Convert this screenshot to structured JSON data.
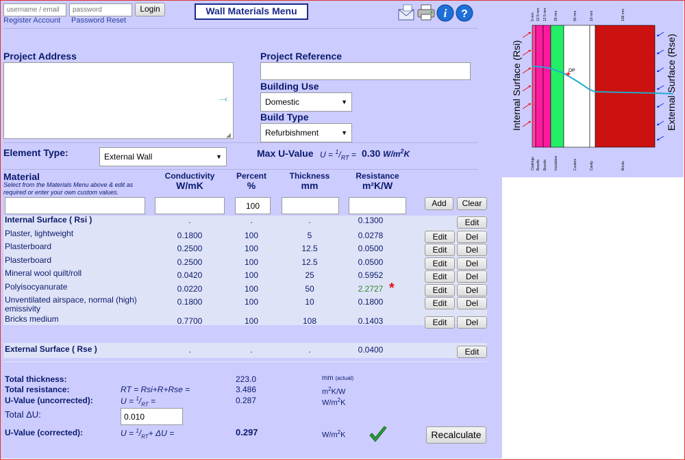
{
  "login": {
    "username_placeholder": "username / email",
    "password_placeholder": "password",
    "login_label": "Login",
    "register_label": "Register Account",
    "reset_label": "Password Reset"
  },
  "menu_title": "Wall Materials Menu",
  "project": {
    "address_label": "Project Address",
    "address_value": "",
    "reference_label": "Project Reference",
    "reference_value": "",
    "building_use_label": "Building Use",
    "building_use_value": "Domestic",
    "build_type_label": "Build Type",
    "build_type_value": "Refurbishment"
  },
  "element": {
    "label": "Element Type:",
    "value": "External Wall",
    "max_u_label": "Max U-Value",
    "max_u_value": "0.30"
  },
  "table": {
    "material_header": "Material",
    "material_hint": "Select from the Materials Menu above & edit as required or enter your own custom values.",
    "conductivity_header": "Conductivity",
    "conductivity_unit": "W/mK",
    "percent_header": "Percent",
    "percent_unit": "%",
    "thickness_header": "Thickness",
    "thickness_unit": "mm",
    "resistance_header": "Resistance",
    "resistance_unit": "m²K/W",
    "entry_percent_value": "100",
    "add_label": "Add",
    "clear_label": "Clear",
    "edit_label": "Edit",
    "del_label": "Del",
    "rows": [
      {
        "name": "Internal Surface ( Rsi )",
        "conductivity": ".",
        "percent": ".",
        "thickness": ".",
        "resistance": "0.1300",
        "kind": "surface"
      },
      {
        "name": "Plaster, lightweight",
        "conductivity": "0.1800",
        "percent": "100",
        "thickness": "5",
        "resistance": "0.0278",
        "kind": "layer"
      },
      {
        "name": "Plasterboard",
        "conductivity": "0.2500",
        "percent": "100",
        "thickness": "12.5",
        "resistance": "0.0500",
        "kind": "layer"
      },
      {
        "name": "Plasterboard",
        "conductivity": "0.2500",
        "percent": "100",
        "thickness": "12.5",
        "resistance": "0.0500",
        "kind": "layer"
      },
      {
        "name": "Mineral wool quilt/roll",
        "conductivity": "0.0420",
        "percent": "100",
        "thickness": "25",
        "resistance": "0.5952",
        "kind": "layer"
      },
      {
        "name": "Polyisocyanurate",
        "conductivity": "0.0220",
        "percent": "100",
        "thickness": "50",
        "resistance": "2.2727",
        "kind": "layer",
        "flag": "*"
      },
      {
        "name": "Unventilated airspace, normal (high) emissivity",
        "conductivity": "0.1800",
        "percent": "100",
        "thickness": "10",
        "resistance": "0.1800",
        "kind": "layer"
      },
      {
        "name": "Bricks medium",
        "conductivity": "0.7700",
        "percent": "100",
        "thickness": "108",
        "resistance": "0.1403",
        "kind": "layer"
      },
      {
        "name": "External Surface ( Rse )",
        "conductivity": ".",
        "percent": ".",
        "thickness": ".",
        "resistance": "0.0400",
        "kind": "surface"
      }
    ]
  },
  "totals": {
    "thickness_label": "Total thickness:",
    "thickness_value": "223.0",
    "thickness_unit": "mm",
    "thickness_unit_note": "(actual)",
    "resistance_label": "Total resistance:",
    "resistance_formula": "RT = Rsi+R+Rse =",
    "resistance_value": "3.486",
    "resistance_unit": "m²K/W",
    "u_uncorrected_label": "U-Value (uncorrected):",
    "u_uncorrected_value": "0.287",
    "u_unit": "W/m²K",
    "delta_u_label": "Total ΔU:",
    "delta_u_value": "0.010",
    "u_corrected_label": "U-Value (corrected):",
    "u_corrected_value": "0.297",
    "recalculate_label": "Recalculate"
  },
  "diagram": {
    "internal_label": "Internal Surface (Rsi)",
    "external_label": "External Surface (Rse)",
    "dp_label": "DP",
    "top_labels": [
      "5 mm",
      "12.5 mm",
      "12.5 mm",
      "25 mm",
      "50 mm",
      "10 mm",
      "108 mm"
    ],
    "bottom_labels": [
      "Coatings",
      "Boards",
      "Boards",
      "Insulation",
      "Custom",
      "Cavity",
      "Bricks"
    ],
    "colors": {
      "coating": "#ff4aa0",
      "board": "#ff1aa0",
      "insulation": "#22ee66",
      "custom": "#ffffff",
      "cavity": "#ffffff",
      "bricks": "#cc1111",
      "temp_line": "#22aacc",
      "dp_marker": "#ff0000"
    }
  },
  "icons": [
    "email-icon",
    "print-icon",
    "info-icon",
    "help-icon",
    "checkmark-icon"
  ]
}
